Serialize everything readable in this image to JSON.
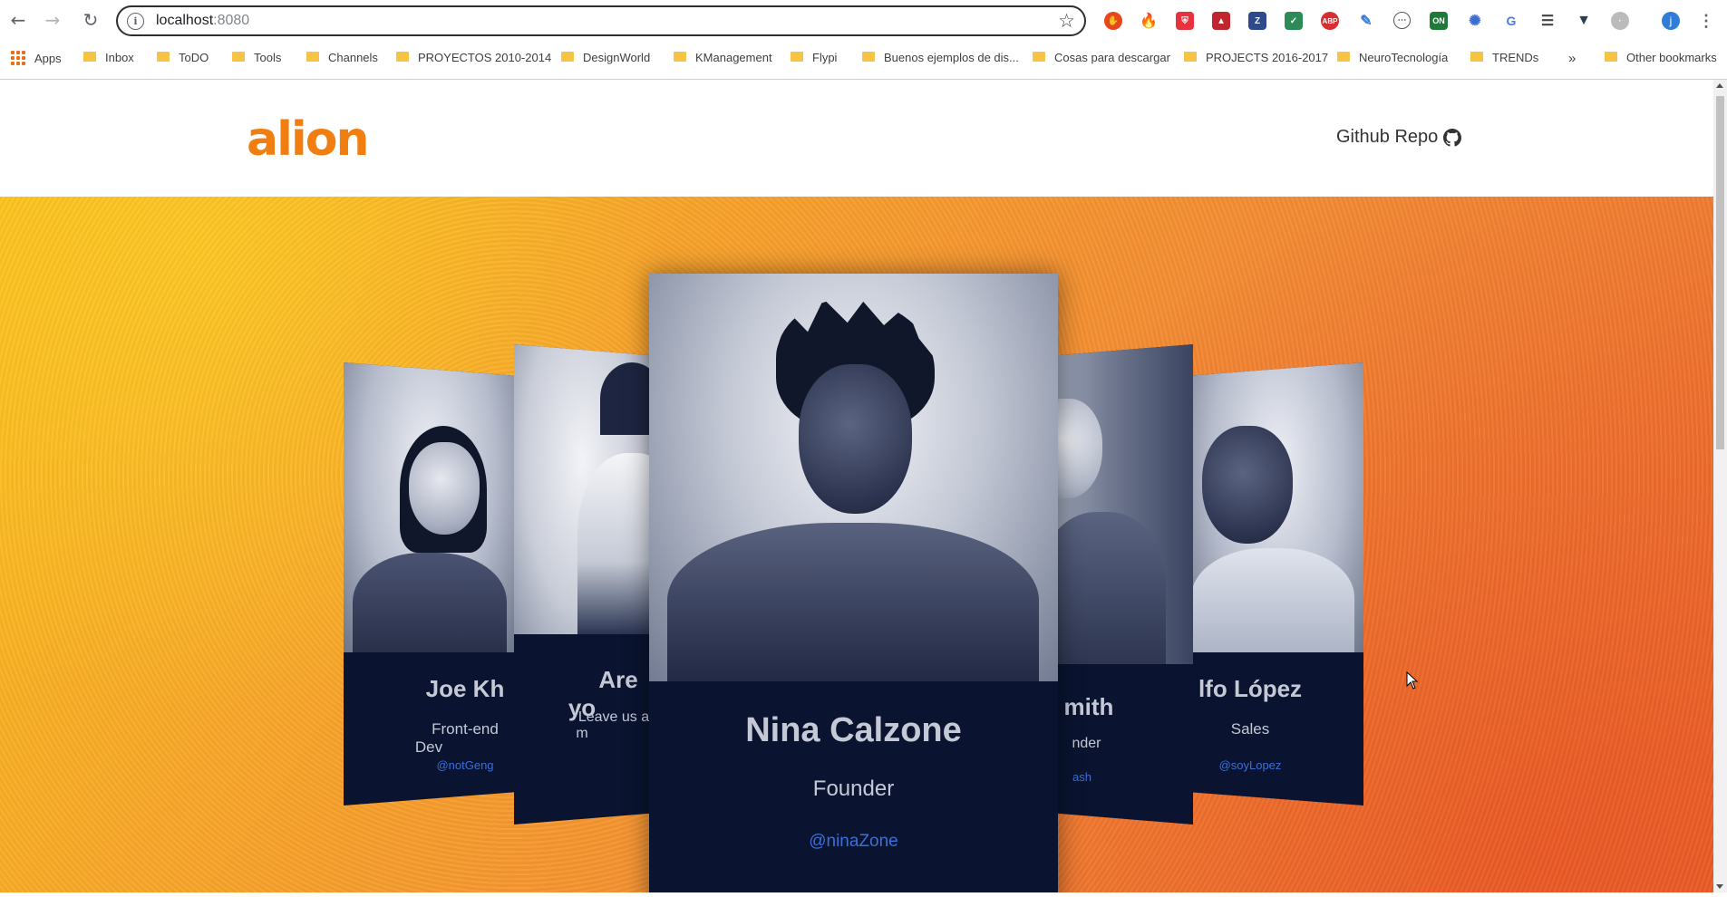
{
  "browser": {
    "url_host": "localhost",
    "url_port": ":8080",
    "profile_initial": "j",
    "bookmarks": [
      {
        "label": "Apps"
      },
      {
        "label": "Inbox"
      },
      {
        "label": "ToDO"
      },
      {
        "label": "Tools"
      },
      {
        "label": "Channels"
      },
      {
        "label": "PROYECTOS 2010-2014"
      },
      {
        "label": "DesignWorld"
      },
      {
        "label": "KManagement"
      },
      {
        "label": "Flypi"
      },
      {
        "label": "Buenos ejemplos de dis..."
      },
      {
        "label": "Cosas para descargar"
      },
      {
        "label": "PROJECTS 2016-2017"
      },
      {
        "label": "NeuroTecnología"
      },
      {
        "label": "TRENDs"
      },
      {
        "label": "Other bookmarks"
      }
    ],
    "overflow_label": "»"
  },
  "site": {
    "logo": "alion",
    "github_label": "Github Repo",
    "accent_color": "#f07e10",
    "card_color": "#0a1430",
    "handle_color": "#3b6fd6"
  },
  "cards": [
    {
      "name": "Joe Kh",
      "role": "Front-end Dev",
      "handle": "@notGeng"
    },
    {
      "name": "Are yo",
      "role": "Leave us a m",
      "handle": ""
    },
    {
      "name": "Nina Calzone",
      "role": "Founder",
      "handle": "@ninaZone"
    },
    {
      "name": "mith",
      "role": "nder",
      "handle": "ash"
    },
    {
      "name": "lfo López",
      "role": "Sales",
      "handle": "@soyLopez"
    }
  ]
}
